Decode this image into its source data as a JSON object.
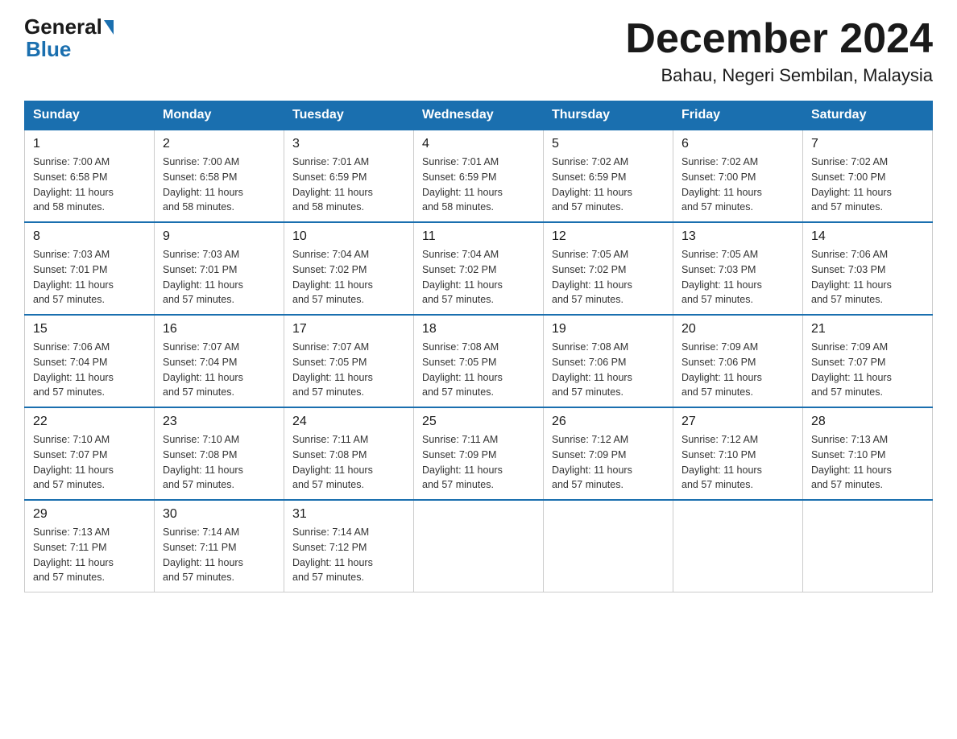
{
  "logo": {
    "general": "General",
    "blue": "Blue",
    "underline": "Blue"
  },
  "header": {
    "month_title": "December 2024",
    "location": "Bahau, Negeri Sembilan, Malaysia"
  },
  "days_of_week": [
    "Sunday",
    "Monday",
    "Tuesday",
    "Wednesday",
    "Thursday",
    "Friday",
    "Saturday"
  ],
  "weeks": [
    [
      {
        "day": "1",
        "sunrise": "7:00 AM",
        "sunset": "6:58 PM",
        "daylight": "11 hours and 58 minutes."
      },
      {
        "day": "2",
        "sunrise": "7:00 AM",
        "sunset": "6:58 PM",
        "daylight": "11 hours and 58 minutes."
      },
      {
        "day": "3",
        "sunrise": "7:01 AM",
        "sunset": "6:59 PM",
        "daylight": "11 hours and 58 minutes."
      },
      {
        "day": "4",
        "sunrise": "7:01 AM",
        "sunset": "6:59 PM",
        "daylight": "11 hours and 58 minutes."
      },
      {
        "day": "5",
        "sunrise": "7:02 AM",
        "sunset": "6:59 PM",
        "daylight": "11 hours and 57 minutes."
      },
      {
        "day": "6",
        "sunrise": "7:02 AM",
        "sunset": "7:00 PM",
        "daylight": "11 hours and 57 minutes."
      },
      {
        "day": "7",
        "sunrise": "7:02 AM",
        "sunset": "7:00 PM",
        "daylight": "11 hours and 57 minutes."
      }
    ],
    [
      {
        "day": "8",
        "sunrise": "7:03 AM",
        "sunset": "7:01 PM",
        "daylight": "11 hours and 57 minutes."
      },
      {
        "day": "9",
        "sunrise": "7:03 AM",
        "sunset": "7:01 PM",
        "daylight": "11 hours and 57 minutes."
      },
      {
        "day": "10",
        "sunrise": "7:04 AM",
        "sunset": "7:02 PM",
        "daylight": "11 hours and 57 minutes."
      },
      {
        "day": "11",
        "sunrise": "7:04 AM",
        "sunset": "7:02 PM",
        "daylight": "11 hours and 57 minutes."
      },
      {
        "day": "12",
        "sunrise": "7:05 AM",
        "sunset": "7:02 PM",
        "daylight": "11 hours and 57 minutes."
      },
      {
        "day": "13",
        "sunrise": "7:05 AM",
        "sunset": "7:03 PM",
        "daylight": "11 hours and 57 minutes."
      },
      {
        "day": "14",
        "sunrise": "7:06 AM",
        "sunset": "7:03 PM",
        "daylight": "11 hours and 57 minutes."
      }
    ],
    [
      {
        "day": "15",
        "sunrise": "7:06 AM",
        "sunset": "7:04 PM",
        "daylight": "11 hours and 57 minutes."
      },
      {
        "day": "16",
        "sunrise": "7:07 AM",
        "sunset": "7:04 PM",
        "daylight": "11 hours and 57 minutes."
      },
      {
        "day": "17",
        "sunrise": "7:07 AM",
        "sunset": "7:05 PM",
        "daylight": "11 hours and 57 minutes."
      },
      {
        "day": "18",
        "sunrise": "7:08 AM",
        "sunset": "7:05 PM",
        "daylight": "11 hours and 57 minutes."
      },
      {
        "day": "19",
        "sunrise": "7:08 AM",
        "sunset": "7:06 PM",
        "daylight": "11 hours and 57 minutes."
      },
      {
        "day": "20",
        "sunrise": "7:09 AM",
        "sunset": "7:06 PM",
        "daylight": "11 hours and 57 minutes."
      },
      {
        "day": "21",
        "sunrise": "7:09 AM",
        "sunset": "7:07 PM",
        "daylight": "11 hours and 57 minutes."
      }
    ],
    [
      {
        "day": "22",
        "sunrise": "7:10 AM",
        "sunset": "7:07 PM",
        "daylight": "11 hours and 57 minutes."
      },
      {
        "day": "23",
        "sunrise": "7:10 AM",
        "sunset": "7:08 PM",
        "daylight": "11 hours and 57 minutes."
      },
      {
        "day": "24",
        "sunrise": "7:11 AM",
        "sunset": "7:08 PM",
        "daylight": "11 hours and 57 minutes."
      },
      {
        "day": "25",
        "sunrise": "7:11 AM",
        "sunset": "7:09 PM",
        "daylight": "11 hours and 57 minutes."
      },
      {
        "day": "26",
        "sunrise": "7:12 AM",
        "sunset": "7:09 PM",
        "daylight": "11 hours and 57 minutes."
      },
      {
        "day": "27",
        "sunrise": "7:12 AM",
        "sunset": "7:10 PM",
        "daylight": "11 hours and 57 minutes."
      },
      {
        "day": "28",
        "sunrise": "7:13 AM",
        "sunset": "7:10 PM",
        "daylight": "11 hours and 57 minutes."
      }
    ],
    [
      {
        "day": "29",
        "sunrise": "7:13 AM",
        "sunset": "7:11 PM",
        "daylight": "11 hours and 57 minutes."
      },
      {
        "day": "30",
        "sunrise": "7:14 AM",
        "sunset": "7:11 PM",
        "daylight": "11 hours and 57 minutes."
      },
      {
        "day": "31",
        "sunrise": "7:14 AM",
        "sunset": "7:12 PM",
        "daylight": "11 hours and 57 minutes."
      },
      null,
      null,
      null,
      null
    ]
  ],
  "labels": {
    "sunrise": "Sunrise:",
    "sunset": "Sunset:",
    "daylight": "Daylight:"
  }
}
